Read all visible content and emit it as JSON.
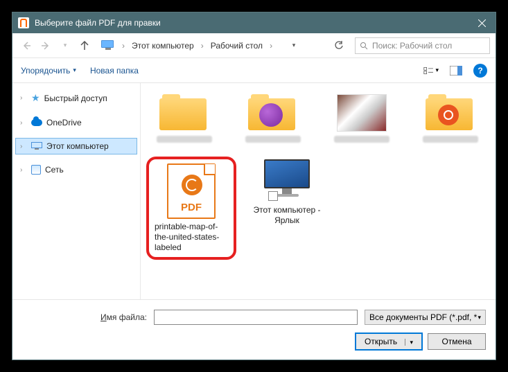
{
  "titlebar": {
    "title": "Выберите файл PDF для правки"
  },
  "breadcrumb": {
    "pc": "Этот компьютер",
    "desktop": "Рабочий стол"
  },
  "search": {
    "placeholder": "Поиск: Рабочий стол"
  },
  "toolbar": {
    "organize": "Упорядочить",
    "newfolder": "Новая папка"
  },
  "tree": {
    "quick": "Быстрый доступ",
    "onedrive": "OneDrive",
    "thispc": "Этот компьютер",
    "network": "Сеть"
  },
  "files": {
    "pdf_label": "PDF",
    "pdf_name": "printable-map-of-the-united-states-labeled",
    "shortcut_name": "Этот компьютер - Ярлык"
  },
  "bottom": {
    "filename_label": "Имя файла:",
    "filter": "Все документы PDF (*.pdf, *.pc",
    "open": "Открыть",
    "cancel": "Отмена"
  }
}
